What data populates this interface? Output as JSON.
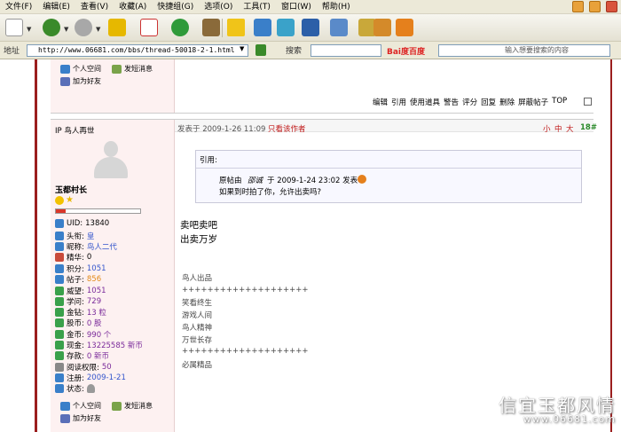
{
  "menu": [
    "文件(F)",
    "编辑(E)",
    "查看(V)",
    "收藏(A)",
    "快捷组(G)",
    "选项(O)",
    "工具(T)",
    "窗口(W)",
    "帮助(H)"
  ],
  "address": {
    "label": "地址",
    "url": "http://www.06681.com/bbs/thread-50018-2-1.html",
    "search_label": "搜索",
    "baidu_label": "Bai度百度",
    "baidu_placeholder": "输入想要搜索的内容"
  },
  "top_actions": {
    "space": "个人空间",
    "message": "发短消息",
    "add_friend": "加为好友"
  },
  "post_actions": [
    "编辑",
    "引用",
    "使用道具",
    "警告",
    "评分",
    "回复",
    "删除",
    "屏蔽帖子",
    "TOP"
  ],
  "post": {
    "ip_author": "IP 鸟人再世",
    "time": "发表于 2009-1-26 11:09",
    "only_author": "只看该作者",
    "font_sizes": [
      "小",
      "中",
      "大"
    ],
    "floor": "18#",
    "quote_title": "引用:",
    "quote_line1_prefix": "原帖由",
    "quote_user": "邵诚",
    "quote_line1_suffix": "于 2009-1-24 23:02 发表",
    "quote_line2": "如果到时拍了你，允许出卖吗?",
    "body": [
      "卖吧卖吧",
      "出卖万岁"
    ],
    "sig": [
      "鸟人出品",
      "++++++++++++++++++++",
      "笑看终生",
      "游戏人间",
      "鸟人精神",
      "万世长存",
      "++++++++++++++++++++",
      "必属精品"
    ]
  },
  "user": {
    "rank": "玉都村长",
    "stats": [
      {
        "label": "UID:",
        "value": "13840"
      },
      {
        "label": "头衔:",
        "value": "皇"
      },
      {
        "label": "昵称:",
        "value": "鸟人二代"
      },
      {
        "label": "精华:",
        "value": "0"
      },
      {
        "label": "积分:",
        "value": "1051"
      },
      {
        "label": "帖子:",
        "value": "856"
      },
      {
        "label": "威望:",
        "value": "1051"
      },
      {
        "label": "学问:",
        "value": "729"
      },
      {
        "label": "金钻:",
        "value": "13 粒"
      },
      {
        "label": "股币:",
        "value": "0 股"
      },
      {
        "label": "金币:",
        "value": "990 个"
      },
      {
        "label": "现金:",
        "value": "13225585 新币"
      },
      {
        "label": "存款:",
        "value": "0 新币"
      },
      {
        "label": "阅读权限:",
        "value": "50"
      },
      {
        "label": "注册:",
        "value": "2009-1-21"
      },
      {
        "label": "状态:",
        "value": ""
      }
    ]
  },
  "watermark": {
    "title": "信宜玉都风情",
    "url": "www.06681.com"
  }
}
